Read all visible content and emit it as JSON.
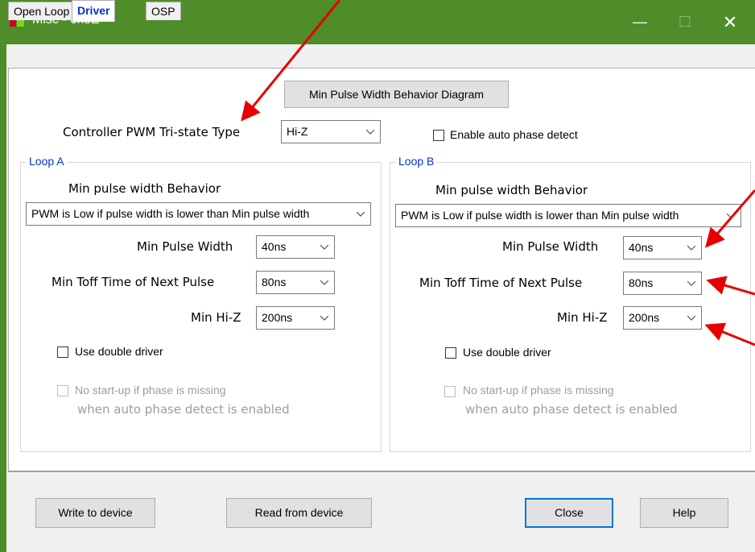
{
  "window": {
    "title": "Misc - 0x3E"
  },
  "titlebar_buttons": {
    "minimize": "—",
    "maximize": "☐",
    "close": "✕"
  },
  "tabs": [
    {
      "label": "Open Loop"
    },
    {
      "label": "Driver"
    },
    {
      "label": "OSP"
    }
  ],
  "top": {
    "diagram_button": "Min Pulse Width Behavior Diagram",
    "tristate_label": "Controller PWM Tri-state Type",
    "tristate_value": "Hi-Z",
    "auto_phase_label": "Enable auto phase detect"
  },
  "loop_a": {
    "title": "Loop A",
    "behavior_label": "Min pulse width Behavior",
    "behavior_value": "PWM is Low if pulse width is lower than Min pulse width",
    "min_pulse_label": "Min Pulse Width",
    "min_pulse_value": "40ns",
    "min_toff_label": "Min Toff Time of Next Pulse",
    "min_toff_value": "80ns",
    "min_hiz_label": "Min Hi-Z",
    "min_hiz_value": "200ns",
    "double_driver_label": "Use double driver",
    "no_startup_line1": "No start-up if phase is missing",
    "no_startup_line2": "when auto phase detect is enabled"
  },
  "loop_b": {
    "title": "Loop B",
    "behavior_label": "Min pulse width Behavior",
    "behavior_value": "PWM is Low if pulse width is lower than Min pulse width",
    "min_pulse_label": "Min Pulse Width",
    "min_pulse_value": "40ns",
    "min_toff_label": "Min Toff Time of Next Pulse",
    "min_toff_value": "80ns",
    "min_hiz_label": "Min Hi-Z",
    "min_hiz_value": "200ns",
    "double_driver_label": "Use double driver",
    "no_startup_line1": "No start-up if phase is missing",
    "no_startup_line2": "when auto phase detect is enabled"
  },
  "footer": {
    "write_label": "Write to device",
    "read_label": "Read from device",
    "close_label": "Close",
    "help_label": "Help"
  },
  "colors": {
    "titlebar": "#4f8d2a",
    "accent_text": "#0033cc",
    "annotation_arrow": "#e60000",
    "focus_border": "#0078d7"
  }
}
